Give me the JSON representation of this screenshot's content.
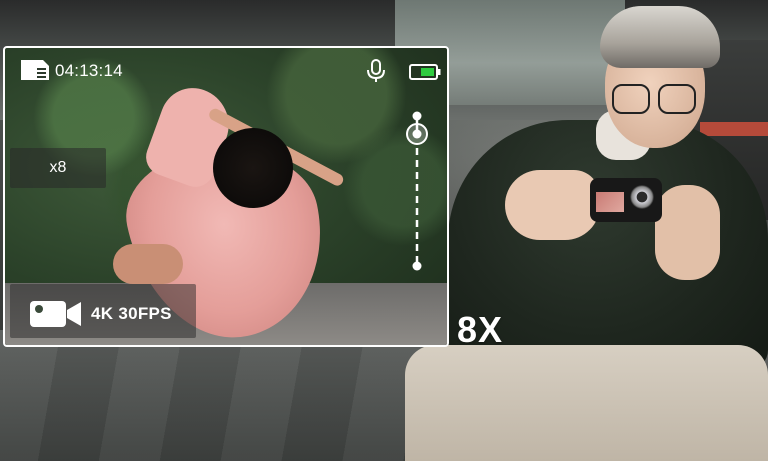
{
  "viewfinder": {
    "timer": "04:13:14",
    "zoom_label": "x8",
    "mode": "4K 30FPS",
    "zoom_level": 0.86
  },
  "overlay": {
    "zoom_caption": "8X"
  },
  "icons": {
    "storage": "sd-card-icon",
    "microphone": "microphone-icon",
    "battery": "battery-icon",
    "video": "video-camera-icon"
  },
  "colors": {
    "battery_fill": "#2ecc40",
    "ui_text": "#ffffff",
    "frame": "#ffffff"
  }
}
